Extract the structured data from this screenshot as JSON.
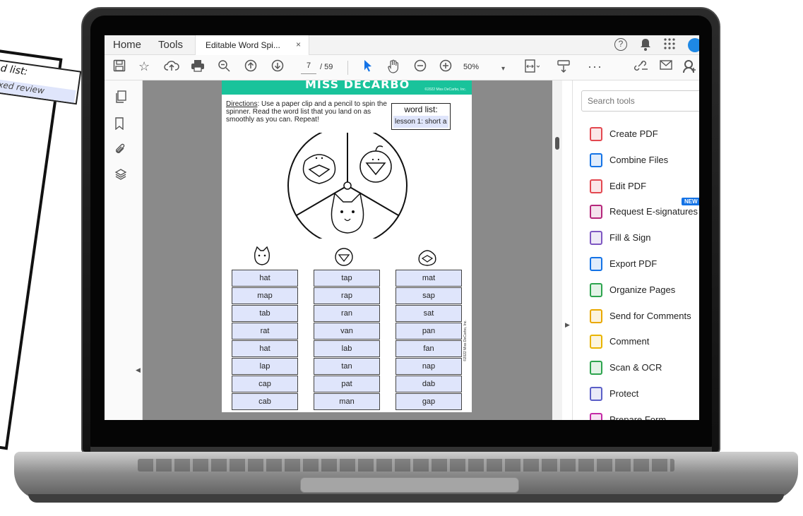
{
  "background_paper": {
    "word_list_title": "d list:",
    "word_list_value": "xed review"
  },
  "menu": {
    "home": "Home",
    "tools": "Tools",
    "document_tab": "Editable Word Spi...",
    "close": "×",
    "help": "?"
  },
  "toolbar": {
    "page_current": "7",
    "page_total": "/ 59",
    "zoom": "50%"
  },
  "document": {
    "brand": "MISS DECARBO",
    "brand_copyright": "©2022 Miss DeCarbo, Inc.",
    "directions_label": "Directions",
    "directions_text": ": Use a paper clip and a pencil to spin the spinner. Read the word list that you land on as smoothly as you can. Repeat!",
    "word_list_title": "word list:",
    "word_list_value": "lesson 1: short a",
    "side_copyright": "©2022 Miss DeCarbo, Inc.",
    "columns": [
      {
        "icon": "cat-icon",
        "words": [
          "hat",
          "map",
          "tab",
          "rat",
          "hat",
          "lap",
          "cap",
          "cab"
        ]
      },
      {
        "icon": "duck-icon",
        "words": [
          "tap",
          "rap",
          "ran",
          "van",
          "lab",
          "tan",
          "pat",
          "man"
        ]
      },
      {
        "icon": "bag-icon",
        "words": [
          "mat",
          "sap",
          "sat",
          "pan",
          "fan",
          "nap",
          "dab",
          "gap"
        ]
      }
    ]
  },
  "tools_panel": {
    "search_placeholder": "Search tools",
    "new_badge": "NEW",
    "items": [
      {
        "label": "Create PDF",
        "icon": "create-pdf-icon",
        "color": "#e34850"
      },
      {
        "label": "Combine Files",
        "icon": "combine-files-icon",
        "color": "#1473e6"
      },
      {
        "label": "Edit PDF",
        "icon": "edit-pdf-icon",
        "color": "#e34850"
      },
      {
        "label": "Request E-signatures",
        "icon": "request-esign-icon",
        "color": "#b5267b"
      },
      {
        "label": "Fill & Sign",
        "icon": "fill-sign-icon",
        "color": "#7e57c2"
      },
      {
        "label": "Export PDF",
        "icon": "export-pdf-icon",
        "color": "#1473e6"
      },
      {
        "label": "Organize Pages",
        "icon": "organize-pages-icon",
        "color": "#2da44e"
      },
      {
        "label": "Send for Comments",
        "icon": "send-comments-icon",
        "color": "#e9a800"
      },
      {
        "label": "Comment",
        "icon": "comment-icon",
        "color": "#e9b400"
      },
      {
        "label": "Scan & OCR",
        "icon": "scan-ocr-icon",
        "color": "#2da44e"
      },
      {
        "label": "Protect",
        "icon": "protect-icon",
        "color": "#5b5fc7"
      },
      {
        "label": "Prepare Form",
        "icon": "prepare-form-icon",
        "color": "#c42aa6"
      }
    ]
  }
}
